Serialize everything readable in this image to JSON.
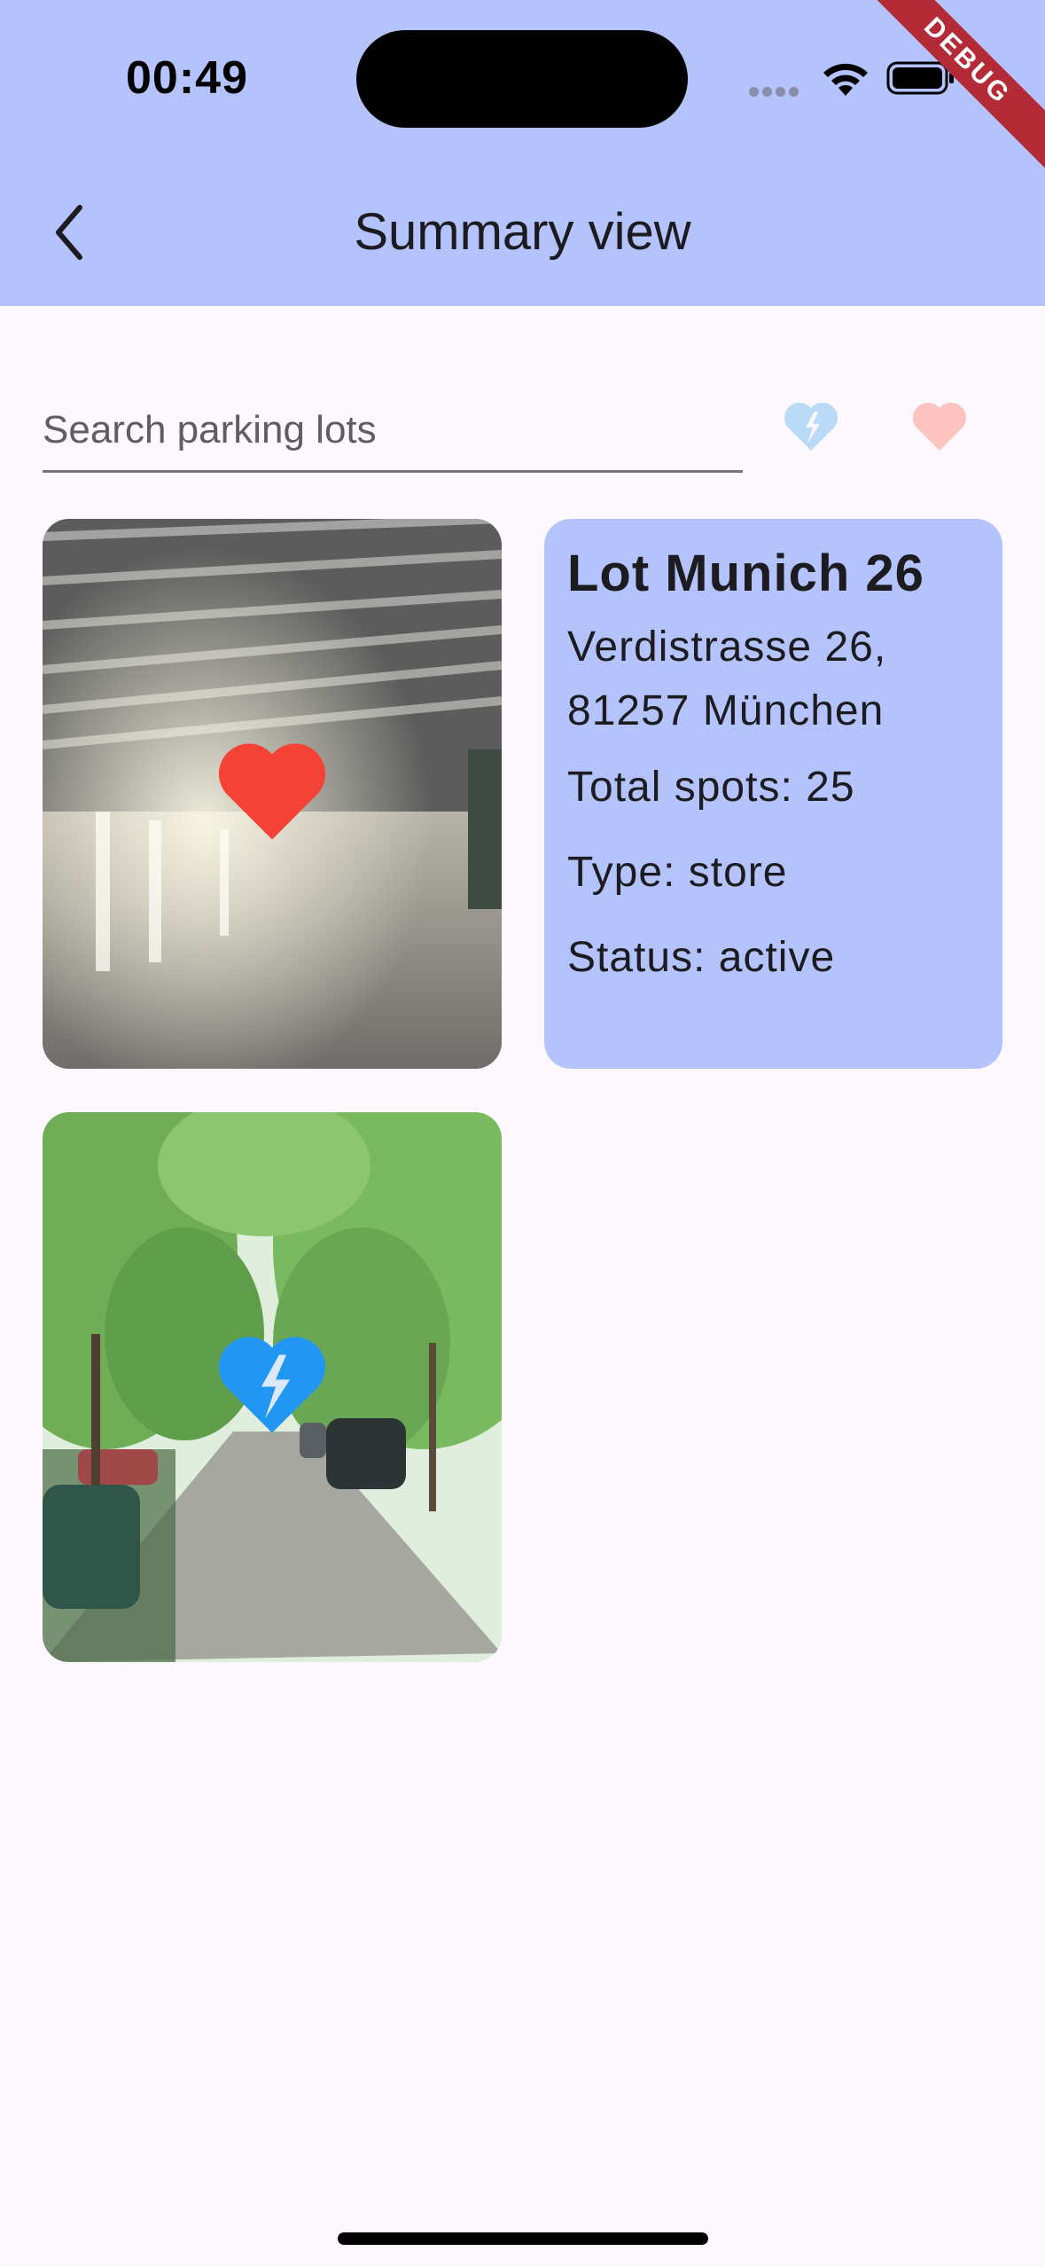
{
  "status_bar": {
    "time": "00:49"
  },
  "debug_banner": "DEBUG",
  "app_bar": {
    "title": "Summary view",
    "back_icon": "chevron-left-icon"
  },
  "search": {
    "placeholder": "Search parking lots",
    "value": ""
  },
  "filters": [
    {
      "icon": "broken-heart-icon",
      "color": "#b9dbf7"
    },
    {
      "icon": "heart-icon",
      "color": "#fdc3c0"
    }
  ],
  "lots": [
    {
      "image": "parking-garage-photo",
      "favorite_icon": "heart-icon",
      "favorite_color": "#f44336",
      "details": {
        "name": "Lot Munich 26",
        "address": "Verdistrasse 26, 81257 München",
        "total_spots": "Total spots: 25",
        "type": "Type: store",
        "status": "Status: active"
      }
    },
    {
      "image": "tree-lined-street-photo",
      "favorite_icon": "broken-heart-icon",
      "favorite_color": "#2196f3"
    }
  ],
  "colors": {
    "app_bar": "#b5c3fd",
    "background": "#fdf8fd",
    "card": "#b5c3fd"
  }
}
